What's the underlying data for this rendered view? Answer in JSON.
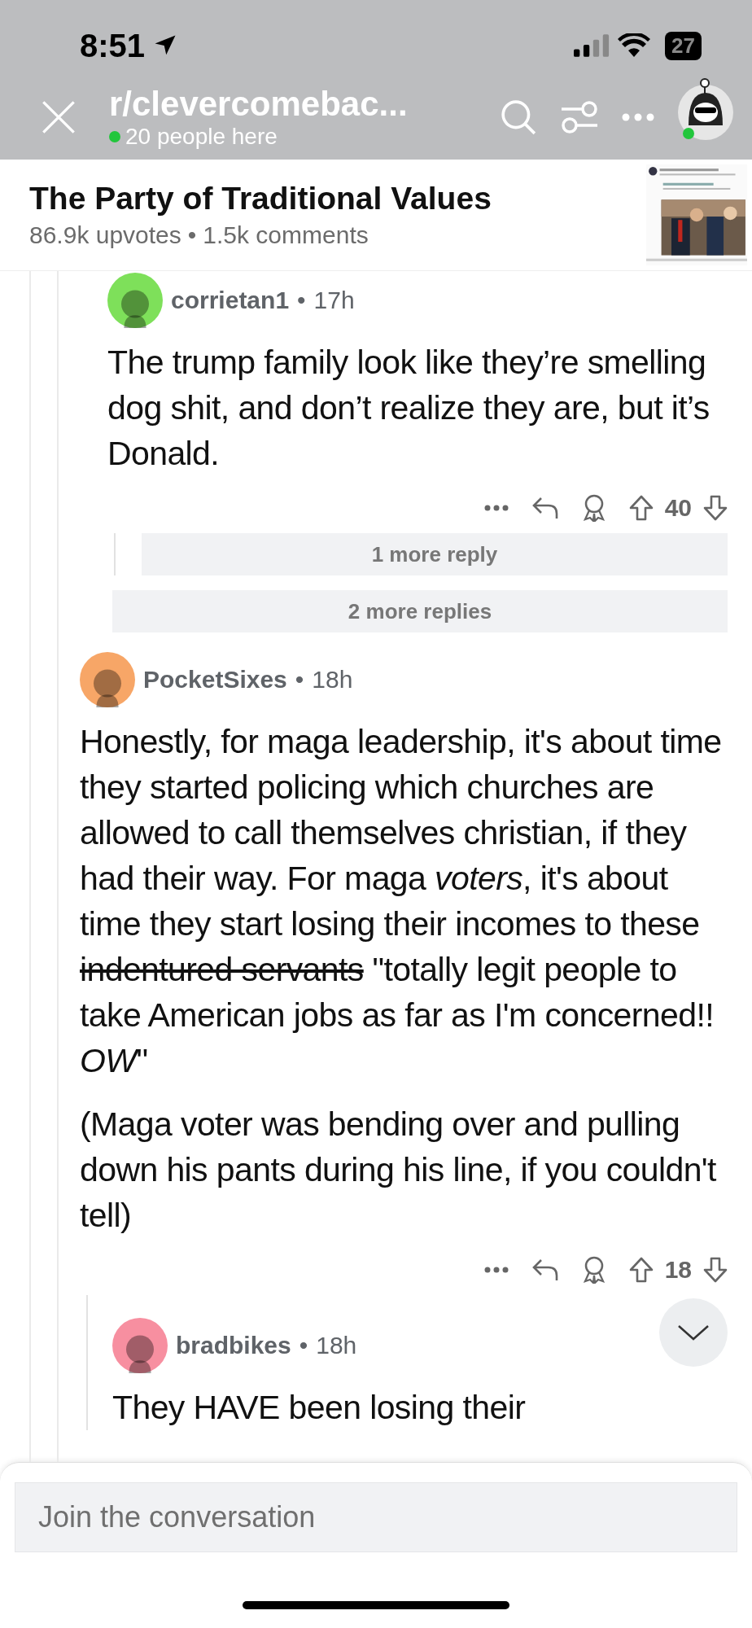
{
  "status_bar": {
    "time": "8:51",
    "battery": "27"
  },
  "header": {
    "subreddit": "r/clevercomebac...",
    "online": "20 people here"
  },
  "post": {
    "title": "The Party of Traditional Values",
    "upvotes": "86.9k upvotes",
    "separator": "•",
    "comments": "1.5k comments"
  },
  "thread": [
    {
      "kind": "comment",
      "username": "corrietan1",
      "separator": "•",
      "age": "17h",
      "color": "#7ee05a",
      "paragraphs": [
        [
          {
            "text": "The trump family look like they’re smelling dog shit, and don’t realize they are, but it’s Donald.",
            "strike": false
          }
        ]
      ],
      "votes": "40",
      "children": [
        {
          "kind": "more",
          "label": "1 more reply"
        }
      ]
    },
    {
      "kind": "more",
      "label": "2 more replies"
    },
    {
      "kind": "comment",
      "username": "PocketSixes",
      "separator": "•",
      "age": "18h",
      "color": "#f7a667",
      "paragraphs": [
        [
          {
            "text": "Honestly, for maga leadership, it's about time they started policing which churches are allowed to call themselves christian, if they had their way. For maga *voters*, it's about time they start losing their incomes to these ",
            "strike": false
          },
          {
            "text": "indentured servants",
            "strike": true
          },
          {
            "text": " \"totally legit people to take American jobs as far as I'm concerned!! *OW*\"",
            "strike": false
          }
        ],
        [
          {
            "text": "(Maga voter was bending over and pulling down his pants during his line, if you couldn't tell)",
            "strike": false
          }
        ]
      ],
      "votes": "18",
      "children": [
        {
          "kind": "comment",
          "username": "bradbikes",
          "separator": "•",
          "age": "18h",
          "color": "#f78fa0",
          "paragraphs": [
            [
              {
                "text": "They HAVE been losing their",
                "strike": false
              }
            ]
          ]
        }
      ]
    }
  ],
  "composer": {
    "placeholder": "Join the conversation"
  }
}
